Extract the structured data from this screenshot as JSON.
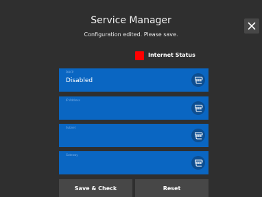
{
  "header": {
    "title": "Service Manager",
    "subtitle": "Configuration edited. Please save."
  },
  "status": {
    "label": "Internet Status",
    "color": "#ff0000"
  },
  "fields": [
    {
      "label": "DHCP",
      "value": "Disabled"
    },
    {
      "label": "IP Address",
      "value": ""
    },
    {
      "label": "Subnet",
      "value": ""
    },
    {
      "label": "Gateway",
      "value": ""
    }
  ],
  "buttons": {
    "save_label": "Save & Check",
    "reset_label": "Reset"
  },
  "icons": {
    "close": "close-icon",
    "keypad": "keypad-icon"
  },
  "colors": {
    "background": "#2f2f2f",
    "field": "#0a66c2",
    "button": "#474747"
  }
}
